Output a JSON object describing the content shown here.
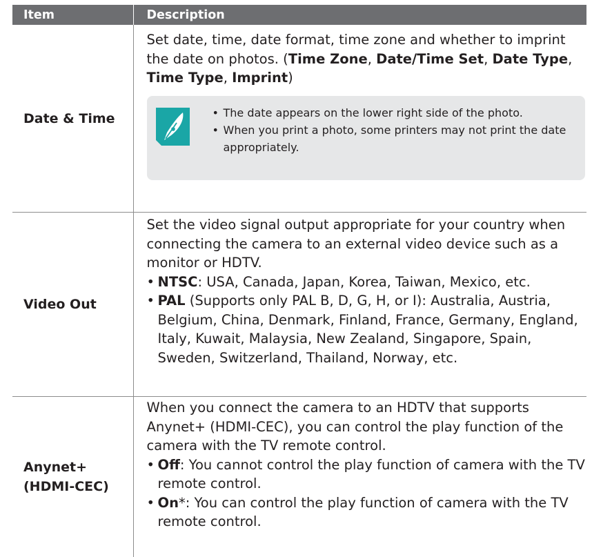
{
  "table": {
    "header": {
      "item": "Item",
      "description": "Description"
    },
    "rows": [
      {
        "item": "Date & Time",
        "desc_plain": "Set date, time, date format, time zone and whether to imprint the date on photos. (",
        "desc_bold_1": "Time Zone",
        "sep_1": ", ",
        "desc_bold_2": "Date/Time Set",
        "sep_2": ", ",
        "desc_bold_3": "Date Type",
        "sep_3": ", ",
        "desc_bold_4": "Time Type",
        "sep_4": ", ",
        "desc_bold_5": "Imprint",
        "desc_close": ")",
        "note": {
          "icon": "note-pen-icon",
          "bullets": [
            "The date appears on the lower right side of the photo.",
            "When you print a photo, some printers may not print the date appropriately."
          ]
        }
      },
      {
        "item": "Video Out",
        "desc": "Set the video signal output appropriate for your country when connecting the camera to an external video device such as a monitor or HDTV.",
        "options": [
          {
            "label": "NTSC",
            "text": ": USA, Canada, Japan, Korea, Taiwan, Mexico, etc."
          },
          {
            "label": "PAL",
            "text": " (Supports only PAL B, D, G, H, or I): Australia, Austria, Belgium, China, Denmark, Finland, France, Germany, England, Italy, Kuwait, Malaysia, New Zealand, Singapore, Spain, Sweden, Switzerland, Thailand, Norway, etc."
          }
        ]
      },
      {
        "item_line1": "Anynet+",
        "item_line2": "(HDMI-CEC)",
        "desc": "When you connect the camera to an HDTV that supports Anynet+ (HDMI-CEC), you can control the play function of the camera with the TV remote control.",
        "options": [
          {
            "label": "Off",
            "text": ": You cannot control the play function of camera with the TV remote control."
          },
          {
            "label": "On",
            "suffix": "*",
            "text": ": You can control the play function of camera with the TV remote control."
          }
        ]
      }
    ]
  },
  "colors": {
    "header_bg": "#6d6e71",
    "note_bg": "#e6e7e8",
    "note_icon": "#1aa6a6"
  },
  "bullet_char": "•"
}
